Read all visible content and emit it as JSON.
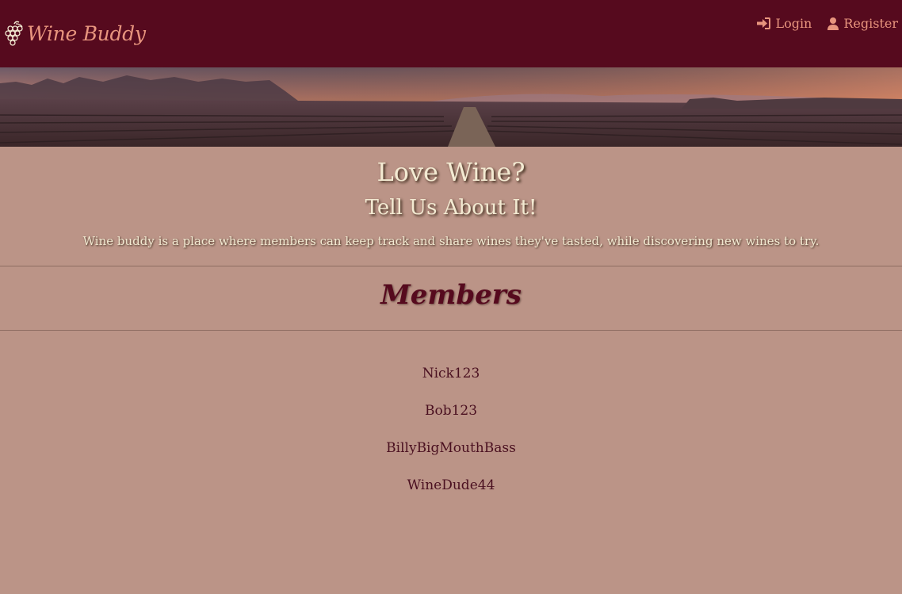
{
  "navbar": {
    "brand_icon": "grapes-icon",
    "brand": "Wine Buddy",
    "links": [
      {
        "label": "Login",
        "icon": "login-icon"
      },
      {
        "label": "Register",
        "icon": "user-icon"
      }
    ]
  },
  "hero": {
    "title": "Love Wine?",
    "subtitle": "Tell Us About It!",
    "description": "Wine buddy is a place where members can keep track and share wines they've tasted, while discovering new wines to try."
  },
  "members": {
    "title": "Members",
    "list": [
      "Nick123",
      "Bob123",
      "BillyBigMouthBass",
      "WineDude44"
    ]
  },
  "colors": {
    "navbar_bg": "#560a1e",
    "page_bg": "#bb9487",
    "accent": "#e8957e",
    "heading_text": "#f3ead2",
    "members_text": "#560a1e"
  }
}
